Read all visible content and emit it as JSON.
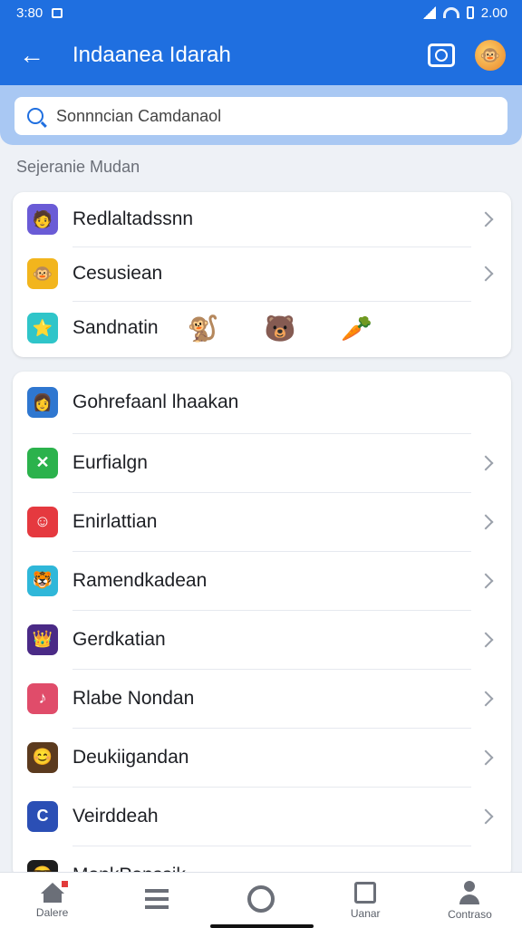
{
  "status_bar": {
    "time": "3:80",
    "right_text": "2.00"
  },
  "app_bar": {
    "title": "Indaanea Idarah"
  },
  "search": {
    "placeholder": "Sonnncian Camdanaol"
  },
  "section_label": "Sejeranie Mudan",
  "card_1": {
    "items": [
      {
        "label": "Redlaltadssnn",
        "icon": "app-icon",
        "color": "#6a5bd6",
        "glyph": "🧑"
      },
      {
        "label": "Cesusiean",
        "icon": "app-icon",
        "color": "#f2b51d",
        "glyph": "🐵"
      },
      {
        "label": "Sandnatin",
        "icon": "app-icon",
        "color": "#2fc5c9",
        "glyph": "⭐"
      }
    ],
    "stickers": [
      "🐒",
      "🐻",
      "🥕"
    ]
  },
  "card_2": {
    "items": [
      {
        "label": "Gohrefaanl lhaakan",
        "color": "#2f77d0",
        "glyph": "👩"
      },
      {
        "label": "Eurfialgn",
        "color": "#2bb24c",
        "glyph": "✕"
      },
      {
        "label": "Enirlattian",
        "color": "#e5393f",
        "glyph": "☺"
      },
      {
        "label": "Ramendkadean",
        "color": "#2fb7d9",
        "glyph": "🐯"
      },
      {
        "label": "Gerdkatian",
        "color": "#4a2a86",
        "glyph": "👑"
      },
      {
        "label": "Rlabe Nondan",
        "color": "#e04c6a",
        "glyph": "♪"
      },
      {
        "label": "Deukiigandan",
        "color": "#5b3a1e",
        "glyph": "😊"
      },
      {
        "label": "Veirddeah",
        "color": "#2b4fb5",
        "glyph": "C"
      },
      {
        "label": "MonkPonssik",
        "color": "#1d1d1d",
        "glyph": "😎"
      }
    ]
  },
  "bottom_nav": [
    {
      "label": "Dalere"
    },
    {
      "label": ""
    },
    {
      "label": ""
    },
    {
      "label": "Uanar"
    },
    {
      "label": "Contraso"
    }
  ]
}
